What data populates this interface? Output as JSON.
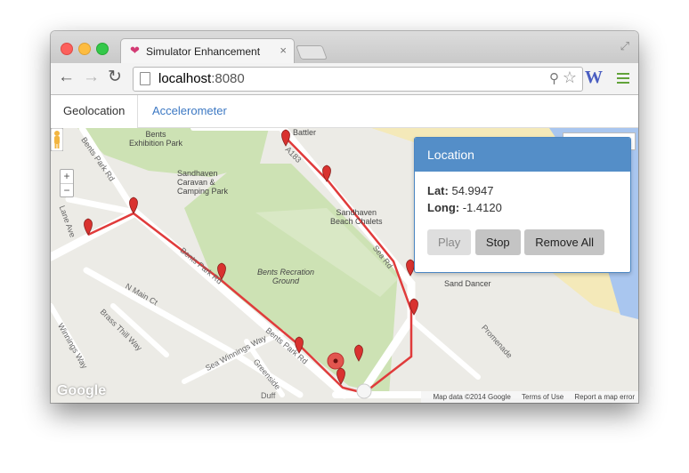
{
  "browser": {
    "tab_title": "Simulator Enhancement",
    "tab_close": "×",
    "url_host": "localhost",
    "url_port": ":8080",
    "extension_label": "W",
    "favicon": "heart-icon"
  },
  "app_tabs": [
    {
      "label": "Geolocation"
    },
    {
      "label": "Accelerometer"
    }
  ],
  "map": {
    "labels": {
      "bents_park": "Bents\nExhibition Park",
      "sandhaven_caravan": "Sandhaven\nCaravan &\nCamping Park",
      "sandhaven_chalets": "Sandhaven\nBeach Chalets",
      "recreation_ground": "Bents Recration\nGround",
      "sand_dancer": "Sand Dancer",
      "battler": "Battler",
      "promenade": "Promenade"
    },
    "roads": {
      "bents_park_rd_top": "Bents Park Rd",
      "a183": "A183",
      "sea_rd": "Sea Rd",
      "n_main_ct": "N Main Ct",
      "brass_thill_way": "Brass Thill Way",
      "bents_park_rd_mid": "Bents Park Rd",
      "bents_park_rd_low": "Bents Park Rd",
      "sea_winnings_way": "Sea Winnings Way",
      "greenside": "Greenside",
      "winnings_way": "Winnings Way",
      "lane_ave": "Lane Ave",
      "duffy": "Duff"
    },
    "zoom_in": "+",
    "zoom_out": "−",
    "logo": "Google",
    "attribution": [
      "Map data ©2014 Google",
      "Terms of Use",
      "Report a map error"
    ]
  },
  "location_panel": {
    "title": "Location",
    "lat_label": "Lat:",
    "lat_value": "54.9947",
    "long_label": "Long:",
    "long_value": "-1.4120",
    "buttons": {
      "play": "Play",
      "stop": "Stop",
      "remove_all": "Remove All"
    }
  },
  "colors": {
    "accent": "#548ec8",
    "route": "#e03b3b",
    "marker": "#d9322f",
    "park": "#cde2b4",
    "beach": "#f4e9b9",
    "sea": "#a9c6ef"
  }
}
